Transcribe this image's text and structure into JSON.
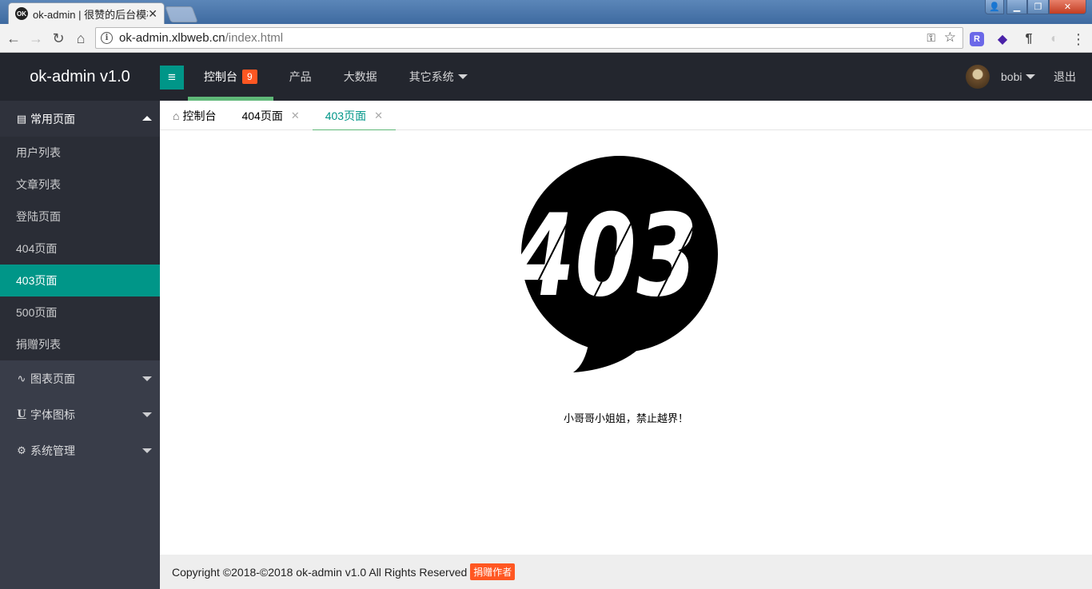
{
  "browser": {
    "tab_title": "ok-admin | 很赞的后台模板",
    "favicon_text": "OK",
    "url_host": "ok-admin.xlbweb.cn",
    "url_path": "/index.html"
  },
  "header": {
    "logo": "ok-admin v1.0",
    "nav": [
      {
        "label": "控制台",
        "badge": "9"
      },
      {
        "label": "产品"
      },
      {
        "label": "大数据"
      },
      {
        "label": "其它系统"
      }
    ],
    "user": "bobi",
    "logout": "退出"
  },
  "sidebar": {
    "groups": [
      {
        "label": "常用页面",
        "icon": "calendar-icon"
      },
      {
        "label": "图表页面",
        "icon": "pulse-icon"
      },
      {
        "label": "字体图标",
        "icon": "underline-icon"
      },
      {
        "label": "系统管理",
        "icon": "gear-icon"
      }
    ],
    "items": [
      "用户列表",
      "文章列表",
      "登陆页面",
      "404页面",
      "403页面",
      "500页面",
      "捐赠列表"
    ],
    "active_item": "403页面"
  },
  "tabs": [
    {
      "label": "控制台"
    },
    {
      "label": "404页面"
    },
    {
      "label": "403页面"
    }
  ],
  "main": {
    "code": "403",
    "message": "小哥哥小姐姐，禁止越界！"
  },
  "footer": {
    "copyright": "Copyright ©2018-©2018 ok-admin v1.0 All Rights Reserved",
    "donate": "捐赠作者"
  },
  "colors": {
    "accent": "#009688",
    "header_bg": "#23262e",
    "sidebar_bg": "#393d49",
    "badge": "#ff5722",
    "tab_indicator": "#5fb878"
  }
}
